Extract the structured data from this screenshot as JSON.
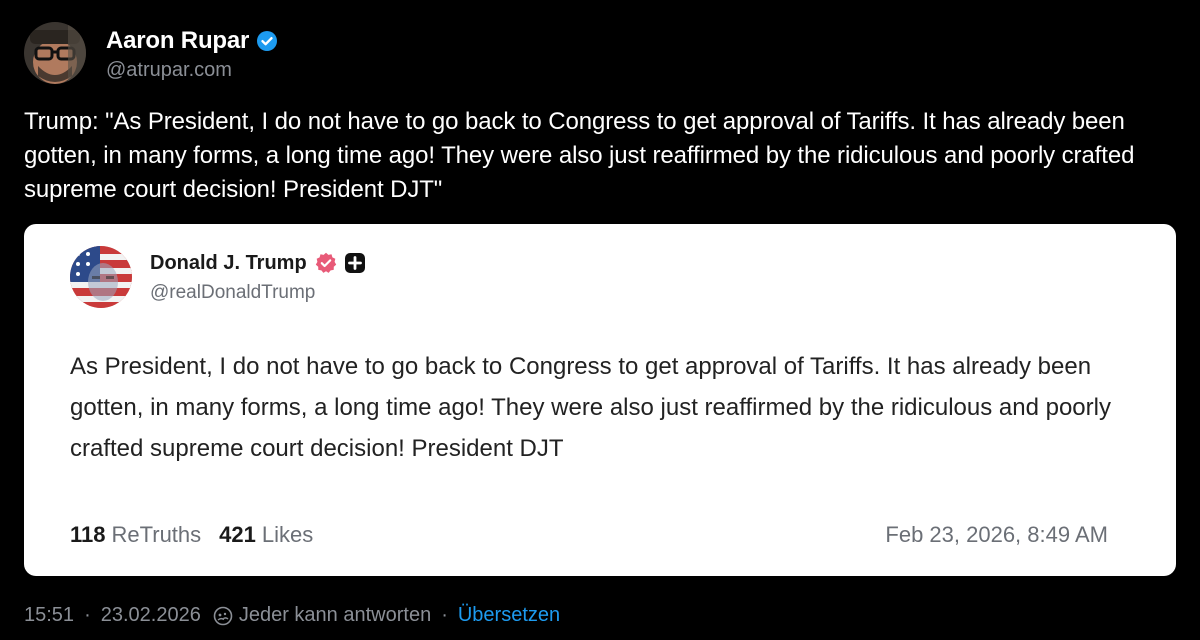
{
  "post": {
    "author_name": "Aaron Rupar",
    "author_handle": "@atrupar.com",
    "text": "Trump: \"As President, I do not have to go back to Congress to get approval of Tariffs. It has already been gotten, in many forms, a long time ago! They were also just reaffirmed by the ridiculous and poorly crafted supreme court decision! President DJT\"",
    "verified_color": "#1d9bf0"
  },
  "embed": {
    "author_name": "Donald J. Trump",
    "author_handle": "@realDonaldTrump",
    "text": "As President, I do not have to go back to Congress to get approval of Tariffs. It has already been gotten, in many forms, a long time ago! They were also just reaffirmed by the ridiculous and poorly crafted supreme court decision! President DJT",
    "retruths_count": "118",
    "retruths_label": "ReTruths",
    "likes_count": "421",
    "likes_label": "Likes",
    "date": "Feb 23, 2026, 8:49 AM",
    "verified_color": "#e85a78"
  },
  "footer": {
    "time": "15:51",
    "dot": "·",
    "date": "23.02.2026",
    "reply_setting": "Jeder kann antworten",
    "dot2": "·",
    "translate": "Übersetzen"
  }
}
